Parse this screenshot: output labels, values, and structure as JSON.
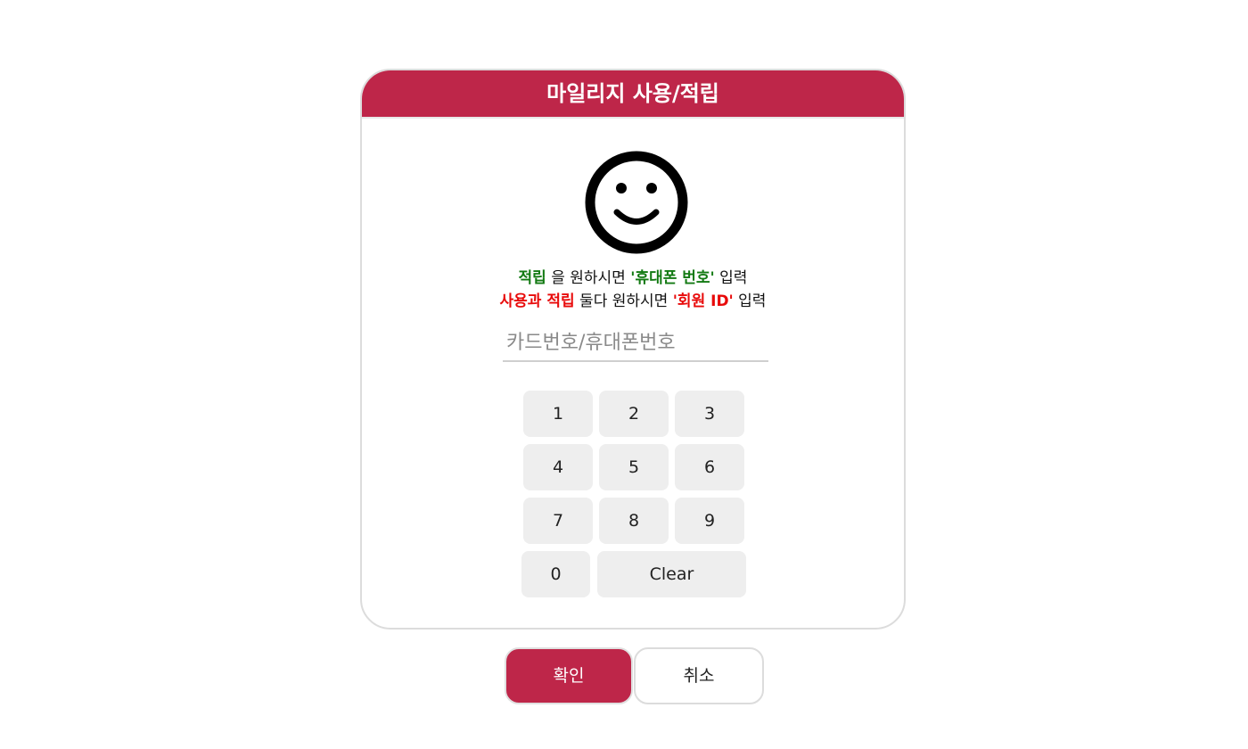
{
  "dialog": {
    "title": "마일리지 사용/적립",
    "message": {
      "line1": {
        "part1": "적립",
        "part2": " 을 원하시면 ",
        "part3": "'휴대폰 번호'",
        "part4": " 입력"
      },
      "line2": {
        "part1": "사용과 적립",
        "part2": " 둘다 원하시면 ",
        "part3": "'회원 ID'",
        "part4": " 입력"
      }
    },
    "input": {
      "placeholder": "카드번호/휴대폰번호",
      "value": ""
    },
    "keypad": {
      "keys": [
        "1",
        "2",
        "3",
        "4",
        "5",
        "6",
        "7",
        "8",
        "9",
        "0"
      ],
      "clear_label": "Clear"
    },
    "smiley_icon": "smiley-face-icon"
  },
  "actions": {
    "confirm_label": "확인",
    "cancel_label": "취소"
  },
  "colors": {
    "accent": "#be2649",
    "green_highlight": "#137a13",
    "red_highlight": "#e80a0a",
    "key_background": "#eeeeee"
  }
}
